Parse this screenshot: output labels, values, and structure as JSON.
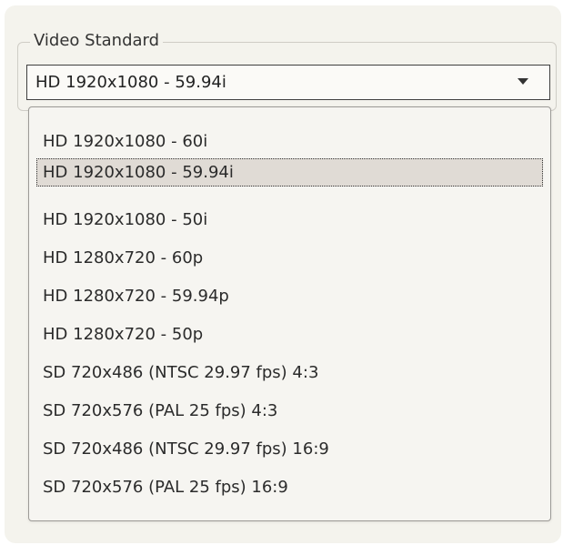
{
  "video_standard": {
    "group_label": "Video Standard",
    "selected_value": "HD 1920x1080 - 59.94i",
    "dropdown_arrow_icon": "chevron-down-icon",
    "options": [
      "HD 1920x1080 - 60i",
      "HD 1920x1080 - 59.94i",
      "HD 1920x1080 - 50i",
      "HD 1280x720 - 60p",
      "HD 1280x720 - 59.94p",
      "HD 1280x720 - 50p",
      "SD 720x486 (NTSC 29.97 fps) 4:3",
      "SD 720x576 (PAL 25 fps) 4:3",
      "SD 720x486 (NTSC 29.97 fps) 16:9",
      "SD 720x576 (PAL 25 fps) 16:9"
    ],
    "highlighted_index": 1
  },
  "colors": {
    "panel_background": "#f4f3ed",
    "selected_option_background": "#e0dbd5"
  }
}
